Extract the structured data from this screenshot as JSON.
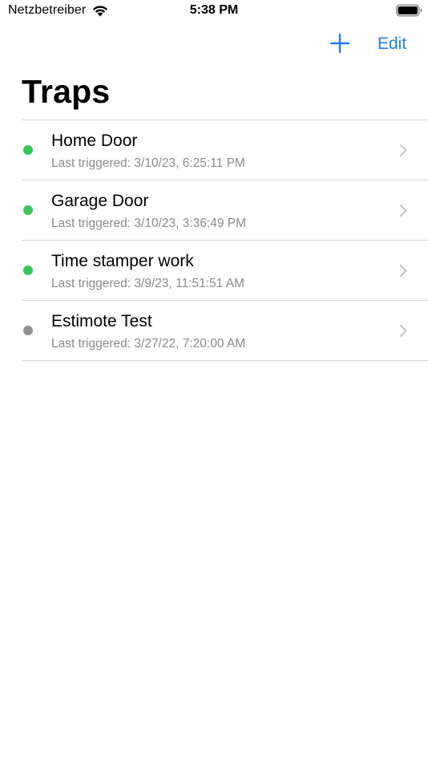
{
  "status_bar": {
    "carrier": "Netzbetreiber",
    "time": "5:38 PM",
    "icons": [
      "wifi-icon",
      "battery-icon"
    ]
  },
  "nav": {
    "add_icon": "plus-icon",
    "edit_label": "Edit",
    "accent_color": "#1f7cf0"
  },
  "page": {
    "title": "Traps"
  },
  "traps": [
    {
      "name": "Home Door",
      "last_triggered": "Last triggered: 3/10/23, 6:25:11 PM",
      "status_color": "#34c759",
      "status": "active"
    },
    {
      "name": "Garage Door",
      "last_triggered": "Last triggered: 3/10/23, 3:36:49 PM",
      "status_color": "#34c759",
      "status": "active"
    },
    {
      "name": "Time stamper work",
      "last_triggered": "Last triggered: 3/9/23, 11:51:51 AM",
      "status_color": "#34c759",
      "status": "active"
    },
    {
      "name": "Estimote Test",
      "last_triggered": "Last triggered: 3/27/22, 7:20:00 AM",
      "status_color": "#8e8e93",
      "status": "inactive"
    }
  ]
}
